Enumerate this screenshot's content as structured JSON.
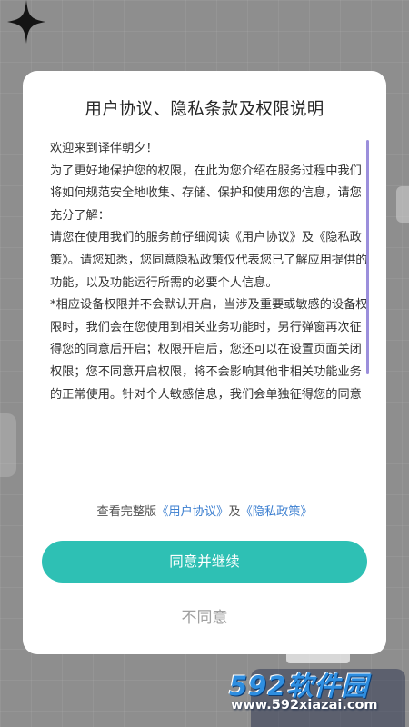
{
  "dialog": {
    "title": "用户协议、隐私条款及权限说明",
    "paragraphs": [
      "欢迎来到译伴朝夕！",
      "为了更好地保护您的权限，在此为您介绍在服务过程中我们将如何规范安全地收集、存储、保护和使用您的信息，请您充分了解：",
      "请您在使用我们的服务前仔细阅读《用户协议》及《隐私政策》。请您知悉，您同意隐私政策仅代表您已了解应用提供的功能，以及功能运行所需的必要个人信息。",
      "*相应设备权限并不会默认开启，当涉及重要或敏感的设备权限时，我们会在您使用到相关业务功能时，另行弹窗再次征得您的同意后开启；权限开启后，您还可以在设置页面关闭权限；您不同意开启权限，将不会影响其他非相关功能业务的正常使用。针对个人敏感信息，我们会单独征得您的同意"
    ],
    "footer": {
      "prefix": "查看完整版",
      "user_agreement": "《用户协议》",
      "conjunction": "及",
      "privacy_policy": "《隐私政策》"
    },
    "agree_label": "同意并继续",
    "disagree_label": "不同意"
  },
  "watermark": {
    "brand": "592软件园",
    "url": "www.592xiazai.com"
  },
  "colors": {
    "accent": "#2ec0b4",
    "link": "#3c7fd0",
    "scrollbar": "#9b8fdb",
    "overlay": "#8e8e8e"
  },
  "icons": [
    "sparkle-icon"
  ]
}
